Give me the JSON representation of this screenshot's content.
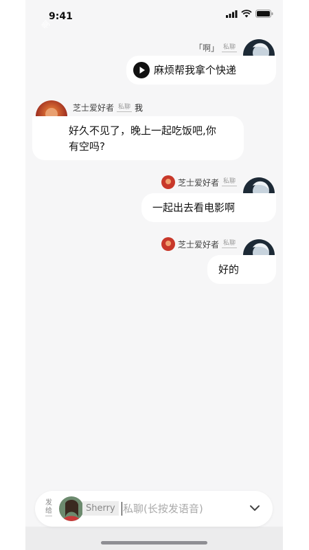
{
  "status": {
    "time": "9:41"
  },
  "ribbon": {
    "text": "啊"
  },
  "messages": [
    {
      "sender": "「啊」",
      "tag": "私聊",
      "text": "麻烦帮我拿个快递",
      "has_play": true
    },
    {
      "sender": "芝士爱好者",
      "tag": "私聊",
      "target": "我",
      "text_line1": "好久不见了，晚上一起吃饭吧,你",
      "text_line2": "有空吗?"
    },
    {
      "sender": "芝士爱好者",
      "tag": "私聊",
      "text": "一起出去看电影啊"
    },
    {
      "sender": "芝士爱好者",
      "tag": "私聊",
      "text": "好的"
    }
  ],
  "input": {
    "send_to_label_1": "发",
    "send_to_label_2": "给",
    "recipient": "Sherry",
    "placeholder": "私聊(长按发语音)"
  },
  "colors": {
    "ribbon": "#d9455b",
    "background": "#f6f6f7"
  }
}
